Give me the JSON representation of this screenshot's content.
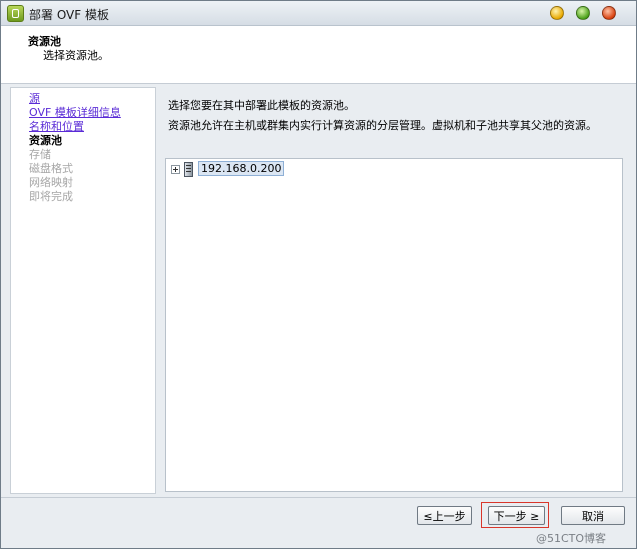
{
  "window": {
    "title": "部署 OVF 模板"
  },
  "header": {
    "title": "资源池",
    "subtitle": "选择资源池。"
  },
  "nav": {
    "items": [
      {
        "label": "源",
        "state": "link"
      },
      {
        "label": "OVF 模板详细信息",
        "state": "link"
      },
      {
        "label": "名称和位置",
        "state": "link"
      },
      {
        "label": "资源池",
        "state": "current"
      },
      {
        "label": "存储",
        "state": "disabled"
      },
      {
        "label": "磁盘格式",
        "state": "disabled"
      },
      {
        "label": "网络映射",
        "state": "disabled"
      },
      {
        "label": "即将完成",
        "state": "disabled"
      }
    ]
  },
  "content": {
    "description_1": "选择您要在其中部署此模板的资源池。",
    "description_2": "资源池允许在主机或群集内实行计算资源的分层管理。虚拟机和子池共享其父池的资源。",
    "tree": {
      "nodes": [
        {
          "label": "192.168.0.200",
          "selected": true,
          "expandable": true
        }
      ]
    }
  },
  "footer": {
    "back_label": "≤上一步",
    "next_label": "下一步 ≥",
    "cancel_label": "取消"
  },
  "watermark": "@51CTO博客",
  "colors": {
    "link": "#5a2bd6",
    "disabled": "#a6a6a6",
    "highlight_box": "#d9362b"
  }
}
